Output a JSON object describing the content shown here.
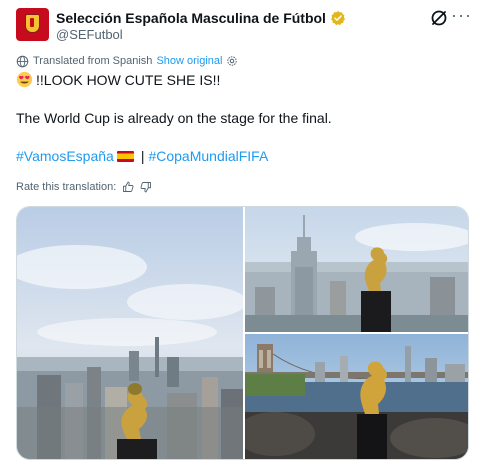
{
  "author": {
    "display_name": "Selección Española Masculina de Fútbol",
    "handle": "@SEFutbol",
    "verified": true,
    "avatar_color": "#c60b1e"
  },
  "header_actions": {
    "grok_icon": "grok-icon",
    "more_icon": "more-icon",
    "more_label": "···"
  },
  "translation": {
    "translated_label": "Translated from Spanish",
    "show_original_label": "Show original",
    "settings_icon": "gear-icon"
  },
  "tweet_text": {
    "line1": "!!LOOK HOW CUTE SHE IS!!",
    "line2": "The World Cup is already on the stage for the final.",
    "hashtag1": "#VamosEspaña",
    "separator": "|",
    "hashtag2": "#CopaMundialFIFA"
  },
  "rating": {
    "label": "Rate this translation:",
    "thumbs_up_icon": "thumbs-up-icon",
    "thumbs_down_icon": "thumbs-down-icon"
  },
  "media": {
    "photos": [
      {
        "description_icon": "photo-skyline-trophy"
      },
      {
        "description_icon": "photo-empire-state-trophy"
      },
      {
        "description_icon": "photo-bridge-trophy"
      }
    ]
  },
  "colors": {
    "link": "#1d9bf0",
    "secondary_text": "#536471",
    "verified_gold": "#e2b719"
  }
}
